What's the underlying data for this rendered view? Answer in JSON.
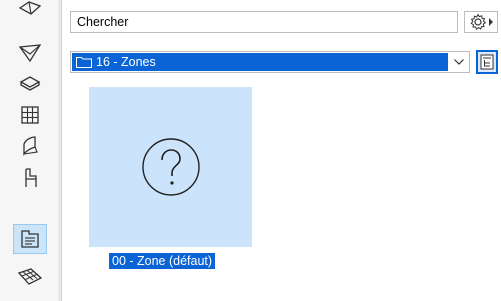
{
  "search": {
    "placeholder": "",
    "value": "Chercher"
  },
  "folder": {
    "selected": "16 - Zones"
  },
  "items": [
    {
      "label": "00 - Zone (défaut)",
      "icon": "question-mark-icon",
      "selected": true
    }
  ],
  "toolbar": {
    "tools": [
      {
        "icon": "roof-icon",
        "active": false
      },
      {
        "icon": "shell-icon",
        "active": false
      },
      {
        "icon": "slab-icon",
        "active": false
      },
      {
        "icon": "curtain-wall-icon",
        "active": false
      },
      {
        "icon": "morph-icon",
        "active": false
      },
      {
        "icon": "chair-object-icon",
        "active": false
      },
      {
        "icon": "zone-icon",
        "active": true
      },
      {
        "icon": "mesh-icon",
        "active": false
      }
    ]
  },
  "colors": {
    "accent": "#0a64d6",
    "selection_bg": "#cce4fb",
    "active_tool_bg": "#cce4f7"
  }
}
